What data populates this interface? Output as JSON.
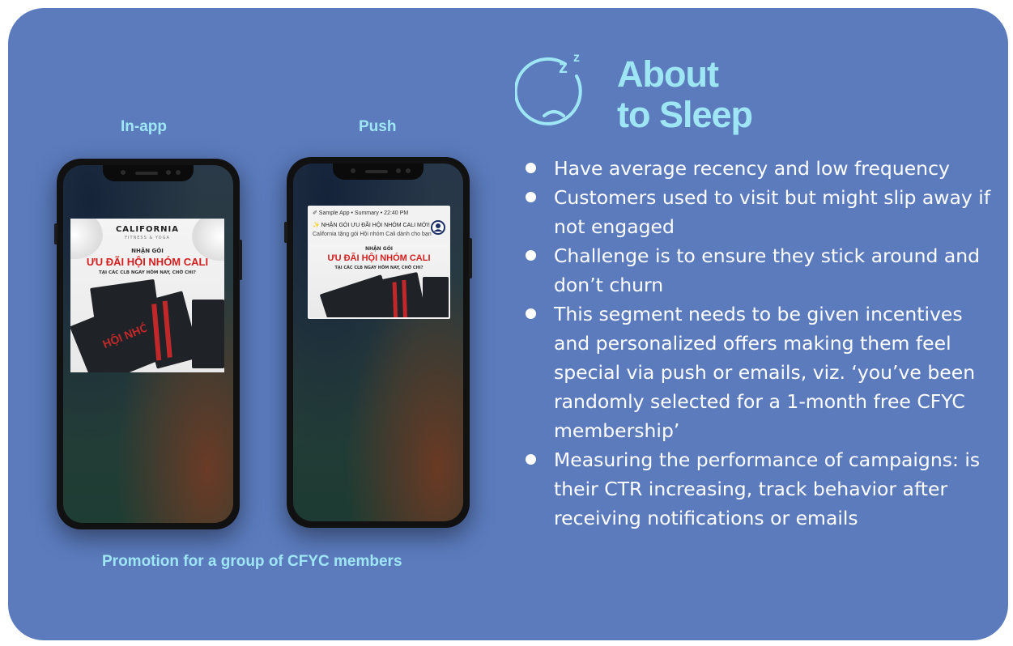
{
  "colors": {
    "card_bg": "#5b7bbd",
    "accent": "#9fe6f5",
    "text": "#ffffff",
    "ad_red": "#d3201f"
  },
  "header": {
    "icon": "sleepy-face-icon",
    "title_line1": "About",
    "title_line2": "to Sleep"
  },
  "labels": {
    "in_app": "In-app",
    "push": "Push",
    "caption": "Promotion for a group of CFYC members"
  },
  "ad": {
    "brand": "CALIFORNIA",
    "brand_sub": "FITNESS & YOGA",
    "small": "NHẬN GÓI",
    "headline": "ƯU ĐÃI HỘI NHÓM CALI",
    "tagline": "TẠI CÁC CLB NGAY HÔM NAY, CHỜ CHI?",
    "box_text": "HỘI NHÓM"
  },
  "notification": {
    "meta": "✐ Sample App • Summary • 22:40 PM",
    "title": "✨ NHẬN GÓI ƯU ĐÃI HỘI NHÓM CALI MỚI!",
    "body": "California tặng gói Hội nhóm Cali dành cho bạn"
  },
  "bullets": [
    "Have average recency and low frequency",
    "Customers used to visit but might slip away if not engaged",
    "Challenge is to ensure they stick around and don’t churn",
    "This segment needs to be given incentives and personalized offers making them feel special via push or emails, viz. ‘you’ve been randomly selected for a 1-month free CFYC membership’",
    "Measuring the performance of campaigns: is their CTR increasing, track behavior after receiving notifications or emails"
  ]
}
